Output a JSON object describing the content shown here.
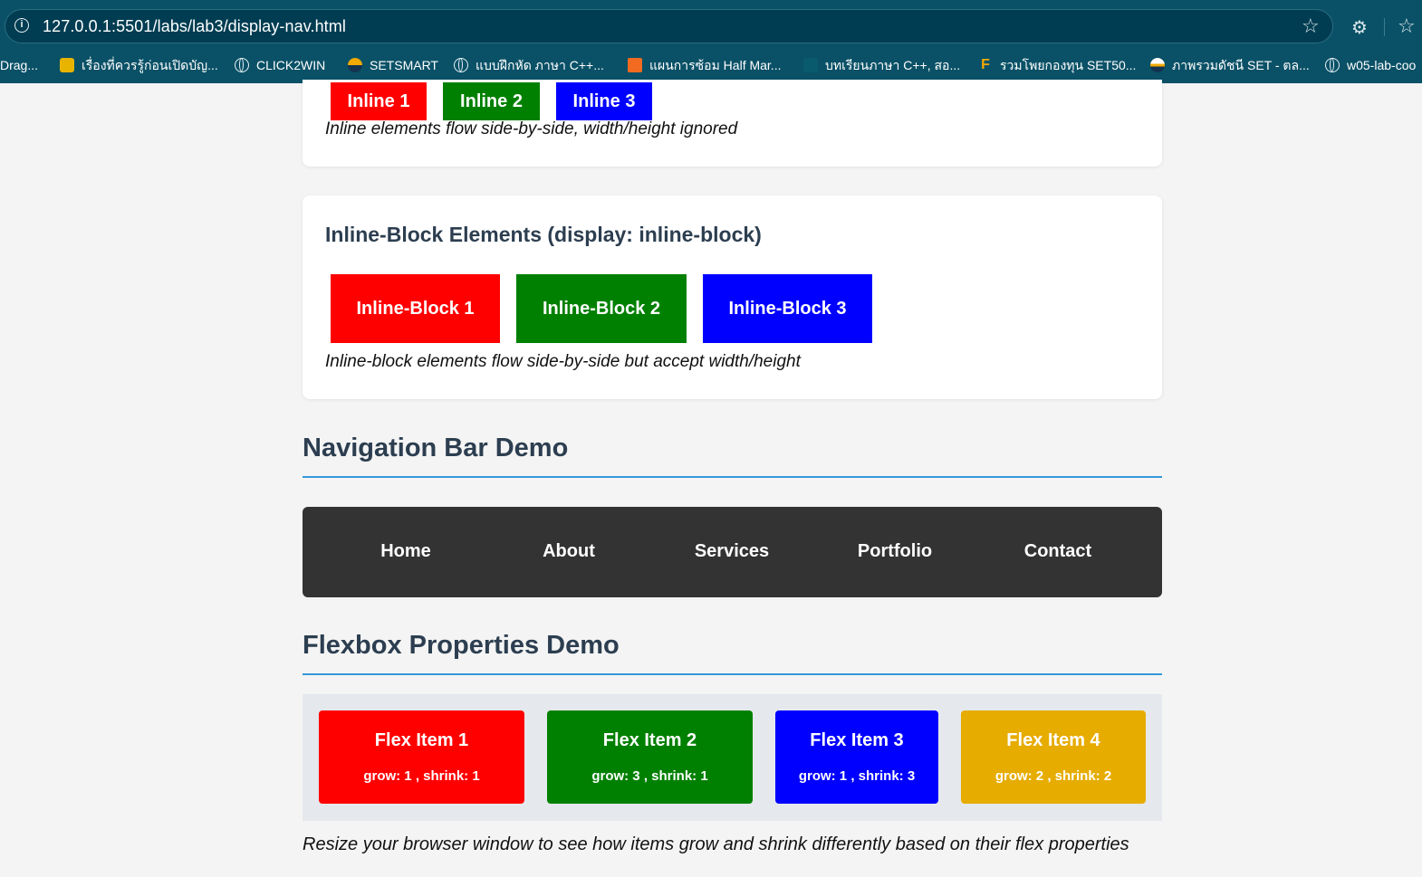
{
  "browser": {
    "url": "127.0.0.1:5501/labs/lab3/display-nav.html",
    "bookmarks": [
      {
        "label": "Drag..."
      },
      {
        "label": "เรื่องที่ควรรู้ก่อนเปิดบัญ..."
      },
      {
        "label": "CLICK2WIN"
      },
      {
        "label": "SETSMART"
      },
      {
        "label": "แบบฝึกหัด ภาษา C++..."
      },
      {
        "label": "แผนการซ้อม Half Mar..."
      },
      {
        "label": "บทเรียนภาษา C++, สอ..."
      },
      {
        "label": "รวมโพยกองทุน SET50..."
      },
      {
        "label": "ภาพรวมดัชนี SET - ตล..."
      },
      {
        "label": "w05-lab-coo"
      }
    ]
  },
  "inline_section": {
    "boxes": [
      {
        "label": "Inline 1",
        "color": "#ff0000"
      },
      {
        "label": "Inline 2",
        "color": "#008000"
      },
      {
        "label": "Inline 3",
        "color": "#0000ff"
      }
    ],
    "caption": "Inline elements flow side-by-side, width/height ignored"
  },
  "inline_block_section": {
    "title": "Inline-Block Elements (display: inline-block)",
    "boxes": [
      {
        "label": "Inline-Block 1",
        "color": "#ff0000"
      },
      {
        "label": "Inline-Block 2",
        "color": "#008000"
      },
      {
        "label": "Inline-Block 3",
        "color": "#0000ff"
      }
    ],
    "caption": "Inline-block elements flow side-by-side but accept width/height"
  },
  "nav_demo": {
    "title": "Navigation Bar Demo",
    "links": [
      "Home",
      "About",
      "Services",
      "Portfolio",
      "Contact"
    ]
  },
  "flex_demo": {
    "title": "Flexbox Properties Demo",
    "items": [
      {
        "title": "Flex Item 1",
        "sub": "grow: 1 , shrink: 1",
        "color": "#ff0000"
      },
      {
        "title": "Flex Item 2",
        "sub": "grow: 3 , shrink: 1",
        "color": "#008000"
      },
      {
        "title": "Flex Item 3",
        "sub": "grow: 1 , shrink: 3",
        "color": "#0000ff"
      },
      {
        "title": "Flex Item 4",
        "sub": "grow: 2 , shrink: 2",
        "color": "#e6ac00"
      }
    ],
    "note": "Resize your browser window to see how items grow and shrink differently based on their flex properties"
  }
}
